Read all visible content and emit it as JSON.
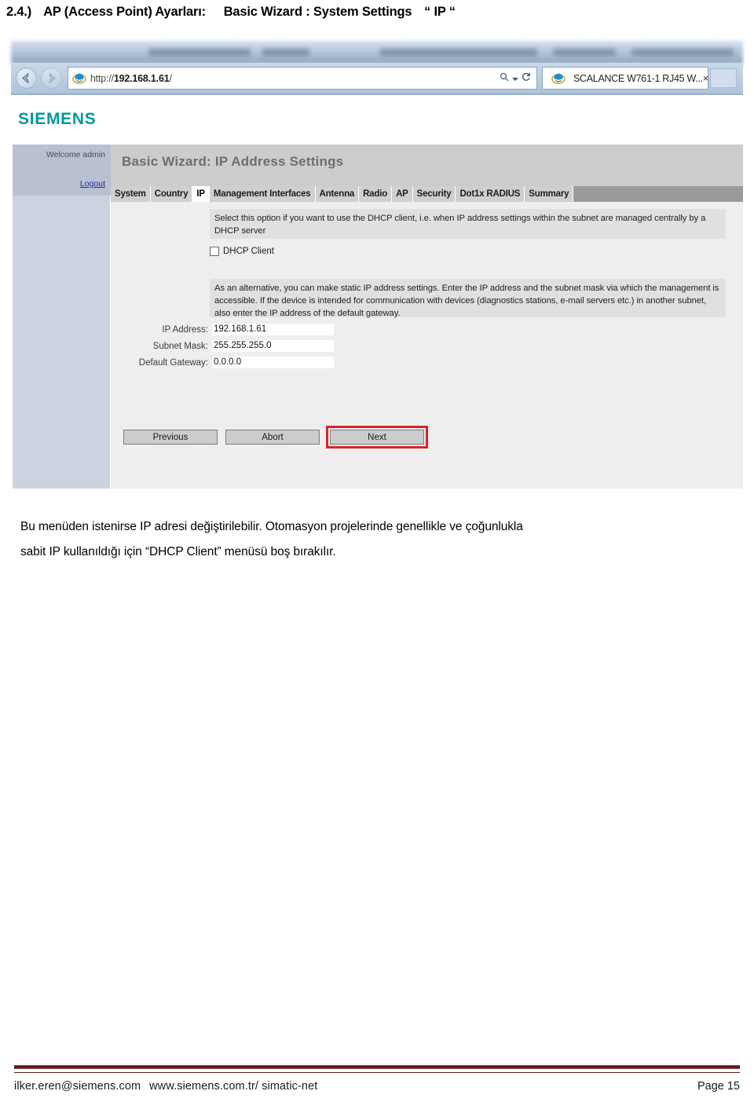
{
  "heading": {
    "number": "2.4.)",
    "main": "AP (Access Point) Ayarları:",
    "sub": "Basic Wizard : System Settings",
    "quoted": "“ IP “"
  },
  "browser": {
    "back_icon": "back-arrow-icon",
    "forward_icon": "forward-arrow-icon",
    "ie_icon": "internet-explorer-icon",
    "url_scheme": "http://",
    "url_host": "192.168.1.61",
    "url_path": "/",
    "search_icon": "search-magnifier-icon",
    "dropdown_icon": "chevron-down-icon",
    "refresh_icon": "refresh-icon",
    "tab_title": "SCALANCE W761-1 RJ45 W...",
    "tab_close": "×"
  },
  "webpage": {
    "brand": "SIEMENS",
    "brand_color": "#009999",
    "sidebar": {
      "welcome": "Welcome admin",
      "logout": "Logout"
    },
    "title": "Basic Wizard: IP Address Settings",
    "tabs": [
      {
        "label": "System",
        "active": false
      },
      {
        "label": "Country",
        "active": false
      },
      {
        "label": "IP",
        "active": true
      },
      {
        "label": "Management Interfaces",
        "active": false
      },
      {
        "label": "Antenna",
        "active": false
      },
      {
        "label": "Radio",
        "active": false
      },
      {
        "label": "AP",
        "active": false
      },
      {
        "label": "Security",
        "active": false
      },
      {
        "label": "Dot1x RADIUS",
        "active": false
      },
      {
        "label": "Summary",
        "active": false
      }
    ],
    "info_dhcp": "Select this option if you want to use the DHCP client, i.e. when IP address settings within the subnet are managed centrally by a DHCP server",
    "dhcp_checkbox_label": "DHCP Client",
    "dhcp_checkbox_checked": false,
    "info_static": "As an alternative, you can make static IP address settings. Enter the IP address and the subnet mask via which the management is accessible. If the device is intended for communication with devices (diagnostics stations, e-mail servers etc.) in another subnet, also enter the IP address of the default gateway.",
    "fields": [
      {
        "label": "IP Address:",
        "value": "192.168.1.61"
      },
      {
        "label": "Subnet Mask:",
        "value": "255.255.255.0"
      },
      {
        "label": "Default Gateway:",
        "value": "0.0.0.0"
      }
    ],
    "buttons": {
      "previous": "Previous",
      "abort": "Abort",
      "next": "Next"
    },
    "highlight_color": "#d8232a"
  },
  "body_text": {
    "line1": "Bu menüden istenirse IP adresi değiştirilebilir. Otomasyon projelerinde genellikle ve çoğunlukla",
    "line2": "sabit IP kullanıldığı için “DHCP Client” menüsü boş bırakılır."
  },
  "footer": {
    "email": "ilker.eren@siemens.com",
    "website": "www.siemens.com.tr/ simatic-net",
    "page": "Page 15",
    "rule_color": "#5b1a1a"
  }
}
